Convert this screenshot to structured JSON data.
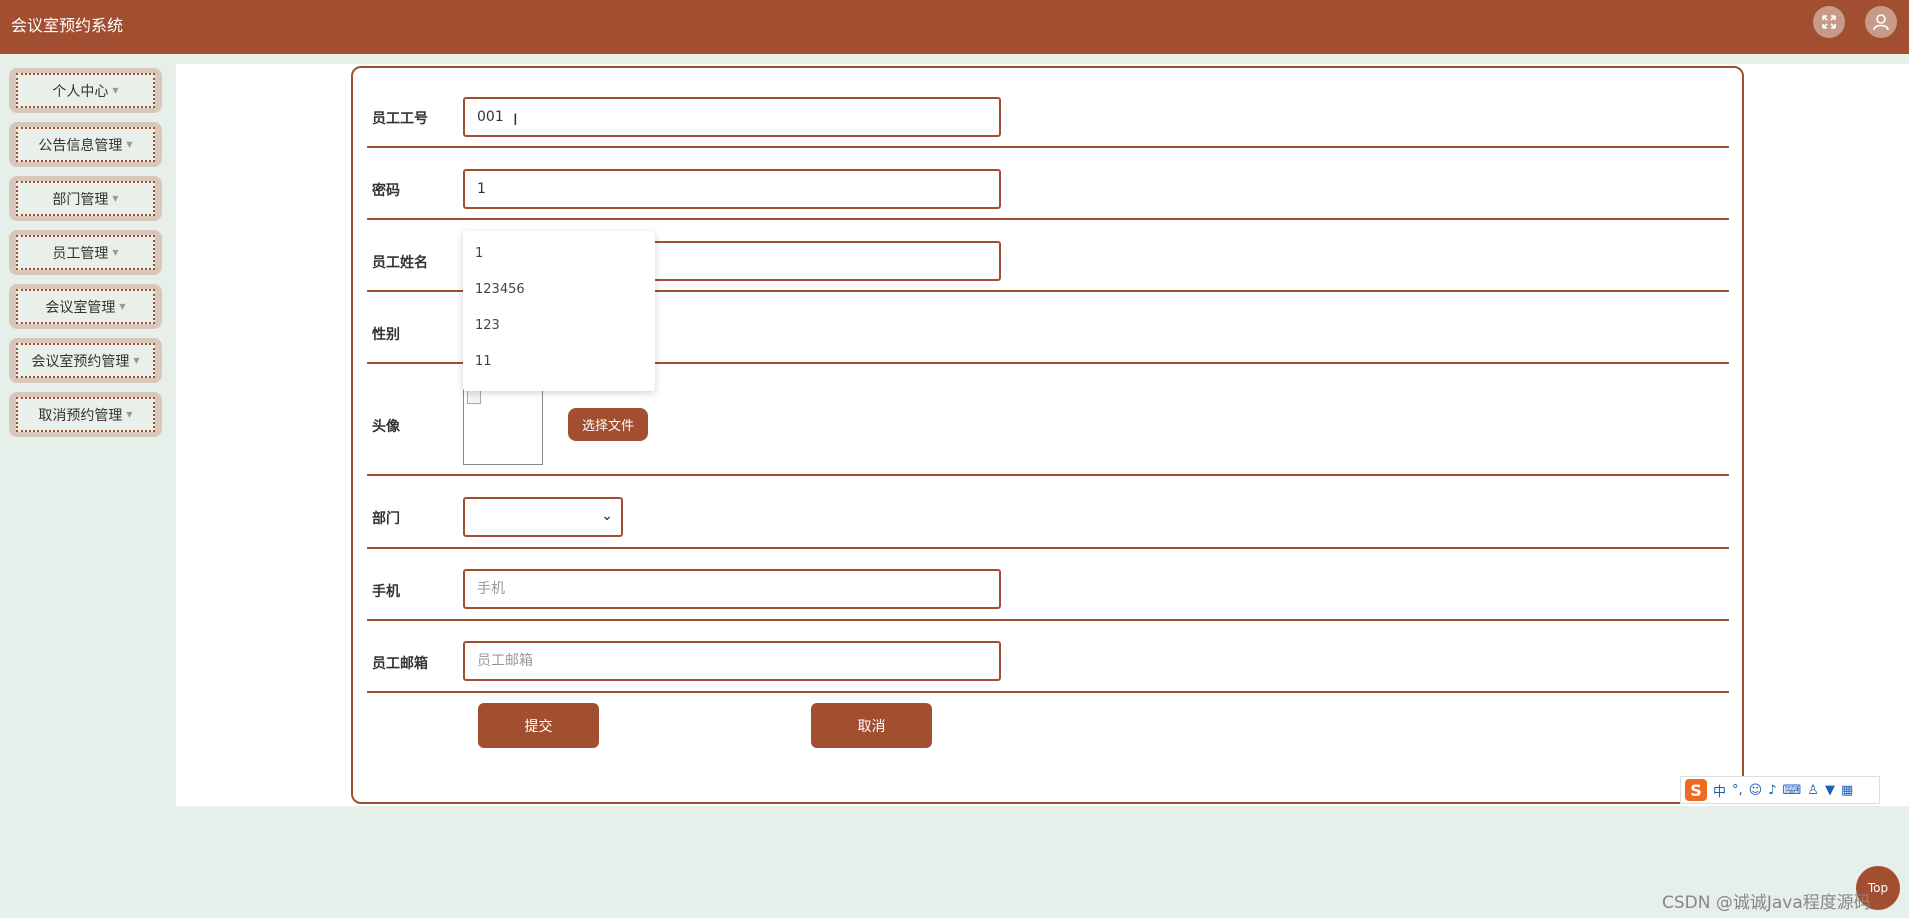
{
  "app": {
    "title": "会议室预约系统"
  },
  "header": {
    "fullscreen_icon": "fullscreen-icon",
    "user_icon": "user-icon"
  },
  "sidebar": {
    "items": [
      {
        "label": "个人中心"
      },
      {
        "label": "公告信息管理"
      },
      {
        "label": "部门管理"
      },
      {
        "label": "员工管理"
      },
      {
        "label": "会议室管理"
      },
      {
        "label": "会议室预约管理"
      },
      {
        "label": "取消预约管理"
      }
    ]
  },
  "form": {
    "employee_no": {
      "label": "员工工号",
      "value": "001"
    },
    "password": {
      "label": "密码",
      "value": "1"
    },
    "employee_name": {
      "label": "员工姓名",
      "value": ""
    },
    "gender": {
      "label": "性别"
    },
    "avatar": {
      "label": "头像",
      "file_button": "选择文件"
    },
    "department": {
      "label": "部门",
      "value": ""
    },
    "phone": {
      "label": "手机",
      "placeholder": "手机"
    },
    "email": {
      "label": "员工邮箱",
      "placeholder": "员工邮箱"
    },
    "submit": "提交",
    "cancel": "取消"
  },
  "autocomplete": {
    "options": [
      "1",
      "123456",
      "123",
      "11"
    ]
  },
  "ime": {
    "mode": "中",
    "punct": "°,"
  },
  "back_to_top": "Top",
  "watermark": "CSDN @诚诚Java程度源码",
  "colors": {
    "brand": "#a14f30",
    "background": "#e6efea"
  }
}
